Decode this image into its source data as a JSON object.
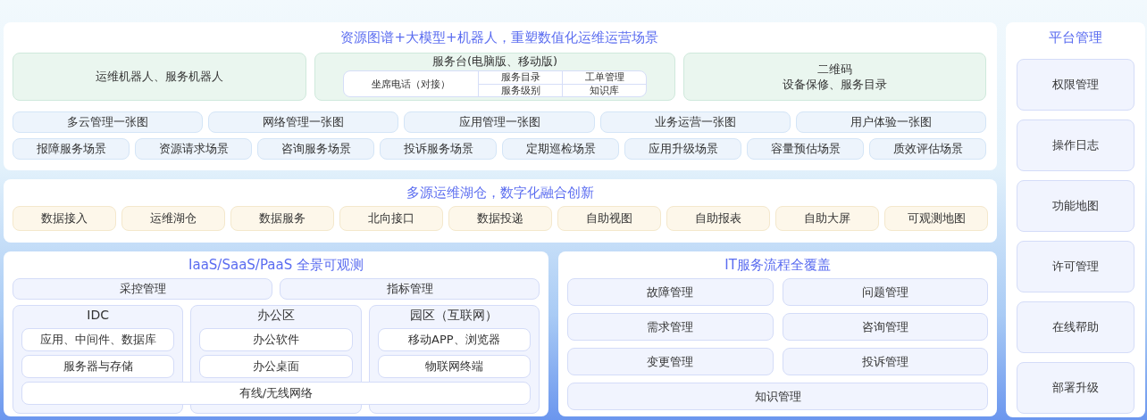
{
  "top": {
    "title": "资源图谱+大模型+机器人，重塑数值化运维运营场景",
    "robot": "运维机器人、服务机器人",
    "service_desk": {
      "title": "服务台(电脑版、移动版)",
      "phone": "坐席电话（对接）",
      "columns": [
        [
          "服务目录",
          "服务级别"
        ],
        [
          "工单管理",
          "知识库"
        ]
      ]
    },
    "qr": {
      "title": "二维码",
      "subtitle": "设备保修、服务目录"
    },
    "maps": [
      "多云管理一张图",
      "网络管理一张图",
      "应用管理一张图",
      "业务运营一张图",
      "用户体验一张图"
    ],
    "scenes": [
      "报障服务场景",
      "资源请求场景",
      "咨询服务场景",
      "投诉服务场景",
      "定期巡检场景",
      "应用升级场景",
      "容量预估场景",
      "质效评估场景"
    ]
  },
  "lake": {
    "title": "多源运维湖仓，数字化融合创新",
    "items": [
      "数据接入",
      "运维湖仓",
      "数据服务",
      "北向接口",
      "数据投递",
      "自助视图",
      "自助报表",
      "自助大屏",
      "可观测地图"
    ]
  },
  "observe": {
    "title": "IaaS/SaaS/PaaS 全景可观测",
    "top_items": [
      "采控管理",
      "指标管理"
    ],
    "zones": [
      {
        "title": "IDC",
        "items": [
          "应用、中间件、数据库",
          "服务器与存储"
        ]
      },
      {
        "title": "办公区",
        "items": [
          "办公软件",
          "办公桌面"
        ]
      },
      {
        "title": "园区（互联网）",
        "items": [
          "移动APP、浏览器",
          "物联网终端"
        ]
      }
    ],
    "network": "有线/无线网络"
  },
  "itsm": {
    "title": "IT服务流程全覆盖",
    "items": [
      "故障管理",
      "问题管理",
      "需求管理",
      "咨询管理",
      "变更管理",
      "投诉管理"
    ],
    "wide_item": "知识管理"
  },
  "platform": {
    "title": "平台管理",
    "items": [
      "权限管理",
      "操作日志",
      "功能地图",
      "许可管理",
      "在线帮助",
      "部署升级"
    ]
  }
}
